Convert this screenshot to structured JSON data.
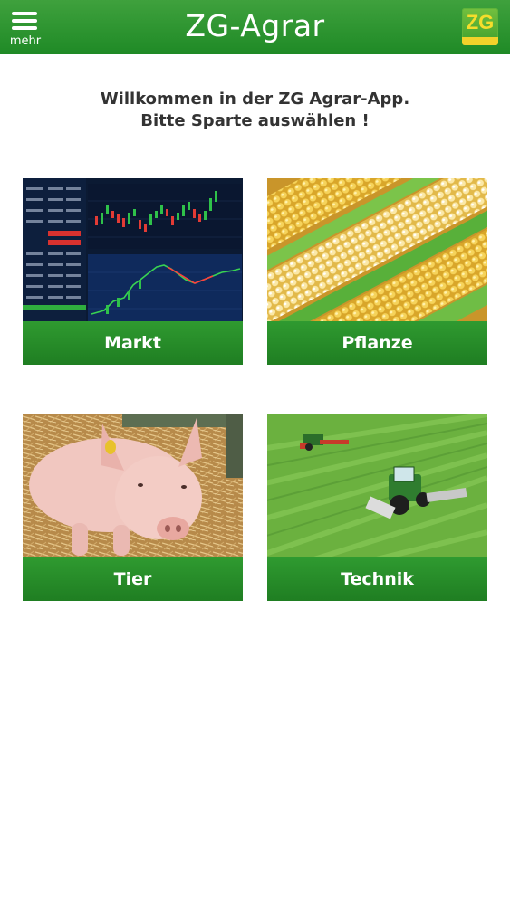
{
  "header": {
    "menu_label": "mehr",
    "title": "ZG-Agrar",
    "logo_text": "ZG"
  },
  "welcome": {
    "line1": "Willkommen in der ZG Agrar-App.",
    "line2": "Bitte Sparte auswählen !"
  },
  "tiles": [
    {
      "label": "Markt",
      "icon": "stock-chart-image"
    },
    {
      "label": "Pflanze",
      "icon": "corn-image"
    },
    {
      "label": "Tier",
      "icon": "pig-image"
    },
    {
      "label": "Technik",
      "icon": "tractor-field-image"
    }
  ],
  "colors": {
    "brand_green": "#2a9530",
    "logo_yellow": "#f2d22a"
  }
}
